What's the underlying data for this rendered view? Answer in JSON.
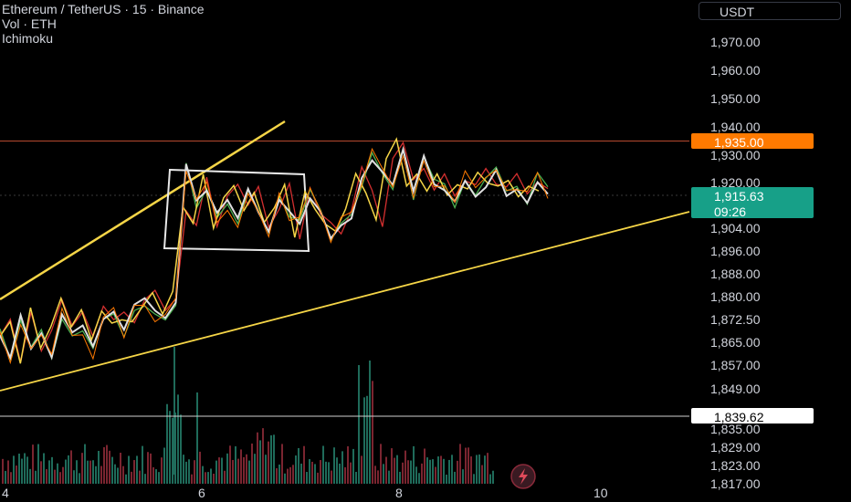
{
  "header": {
    "title": "Ethereum / TetherUS · 15 · Binance",
    "volume_label": "Vol · ETH",
    "indicator_label": "Ichimoku"
  },
  "currency_button": "USDT",
  "colors": {
    "background": "#000000",
    "yellow": "#f5d547",
    "white": "#e0e0e0",
    "red": "#d32f2f",
    "green": "#4caf50",
    "orange": "#ff7a00",
    "teal": "#17a088",
    "resistance_line": "#b54a2e",
    "volume_green": "#1f6b5a",
    "volume_red": "#7a2530"
  },
  "price_tags": {
    "resistance": "1,935.00",
    "current_price": "1,915.63",
    "countdown": "09:26",
    "support": "1,839.62"
  },
  "chart_data": {
    "type": "line",
    "y_axis_labels": [
      "1,970.00",
      "1,960.00",
      "1,950.00",
      "1,940.00",
      "1,930.00",
      "1,920.00",
      "1,904.00",
      "1,896.00",
      "1,888.00",
      "1,880.00",
      "1,872.50",
      "1,865.00",
      "1,857.00",
      "1,849.00",
      "1,835.00",
      "1,829.00",
      "1,823.00",
      "1,817.00"
    ],
    "x_axis_labels": [
      "4",
      "6",
      "8",
      "10"
    ],
    "horizontal_levels": [
      1935.0,
      1839.62
    ],
    "current_price": 1915.63,
    "series": [
      {
        "values": [
          1866,
          1872,
          1858,
          1875,
          1862,
          1870,
          1878,
          1870,
          1874,
          1866,
          1876,
          1872,
          1874,
          1871,
          1878,
          1882,
          1875,
          1880,
          1910,
          1905,
          1923,
          1905,
          1915,
          1920,
          1912,
          1918,
          1905,
          1910,
          1920,
          1900,
          1918,
          1910,
          1905,
          1902,
          1910,
          1925,
          1918,
          1905,
          1928,
          1935,
          1920,
          1925,
          1918,
          1922,
          1915,
          1920,
          1918,
          1925,
          1920,
          1918,
          1922,
          1916,
          1920,
          1918
        ]
      },
      {
        "values": [
          1868,
          1860,
          1872,
          1864,
          1870,
          1858,
          1874,
          1868,
          1870,
          1862,
          1872,
          1874,
          1868,
          1876,
          1878,
          1874,
          1872,
          1878,
          1926,
          1912,
          1918,
          1908,
          1912,
          1906,
          1916,
          1910,
          1902,
          1914,
          1908,
          1906,
          1916,
          1912,
          1900,
          1905,
          1908,
          1920,
          1930,
          1924,
          1918,
          1932,
          1915,
          1928,
          1920,
          1918,
          1912,
          1922,
          1916,
          1920,
          1924,
          1916,
          1918,
          1914,
          1922,
          1917
        ]
      }
    ],
    "lines": [
      {
        "name": "upper trendline",
        "from": [
          0,
          1877
        ],
        "to": [
          14,
          1938
        ]
      },
      {
        "name": "lower trendline",
        "from": [
          0,
          1850
        ],
        "to": [
          44,
          1909
        ]
      }
    ]
  }
}
